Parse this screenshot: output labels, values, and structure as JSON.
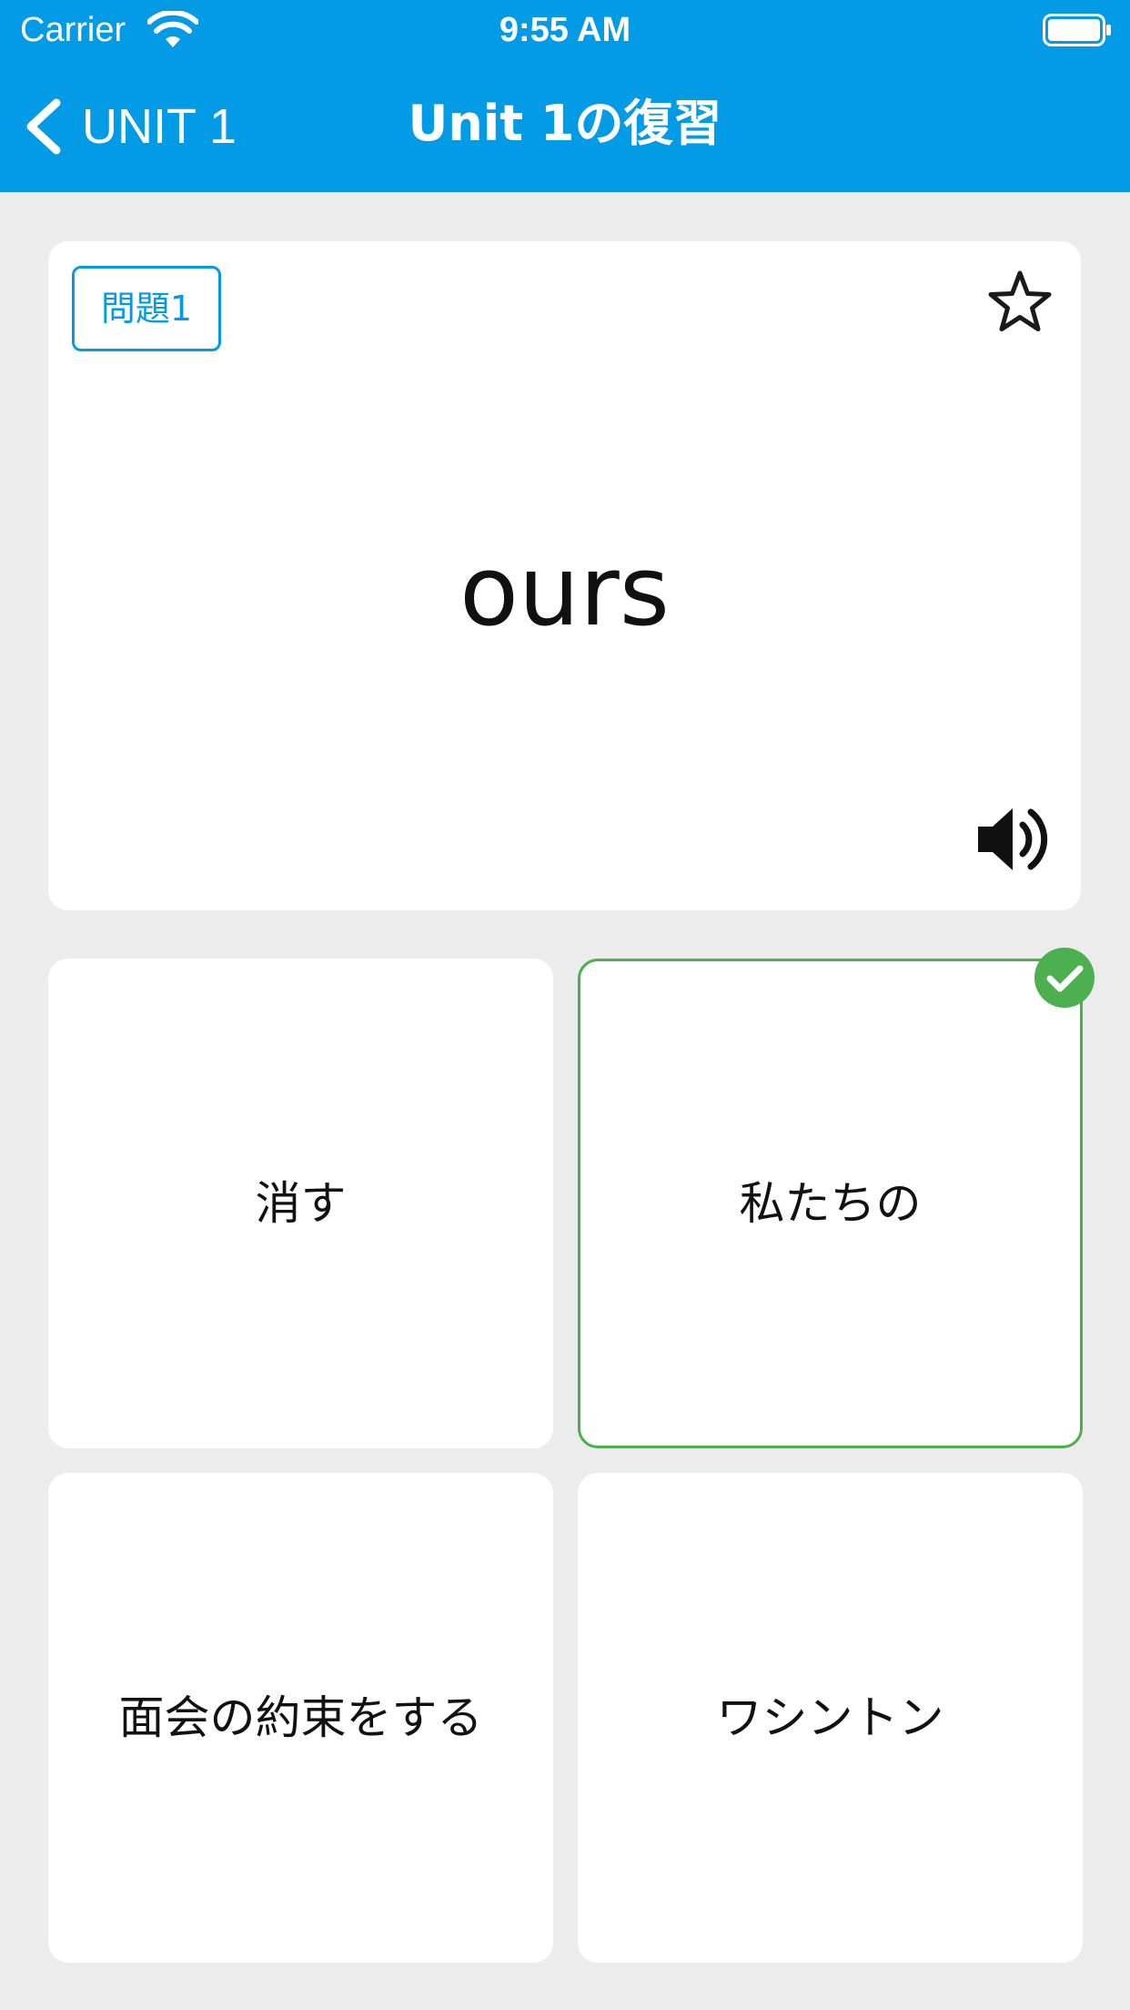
{
  "status_bar": {
    "carrier": "Carrier",
    "time": "9:55 AM"
  },
  "nav": {
    "back_label": "UNIT 1",
    "title": "Unit 1の復習"
  },
  "question": {
    "badge": "問題1",
    "word": "ours",
    "star_icon": "star-outline-icon",
    "speaker_icon": "speaker-icon"
  },
  "options": [
    {
      "label": "消す",
      "state": "default"
    },
    {
      "label": "私たちの",
      "state": "correct"
    },
    {
      "label": "面会の約束をする",
      "state": "default"
    },
    {
      "label": "ワシントン",
      "state": "default"
    }
  ],
  "colors": {
    "header": "#039be5",
    "background": "#ececec",
    "accent": "#039be5",
    "correct": "#4caf50"
  }
}
